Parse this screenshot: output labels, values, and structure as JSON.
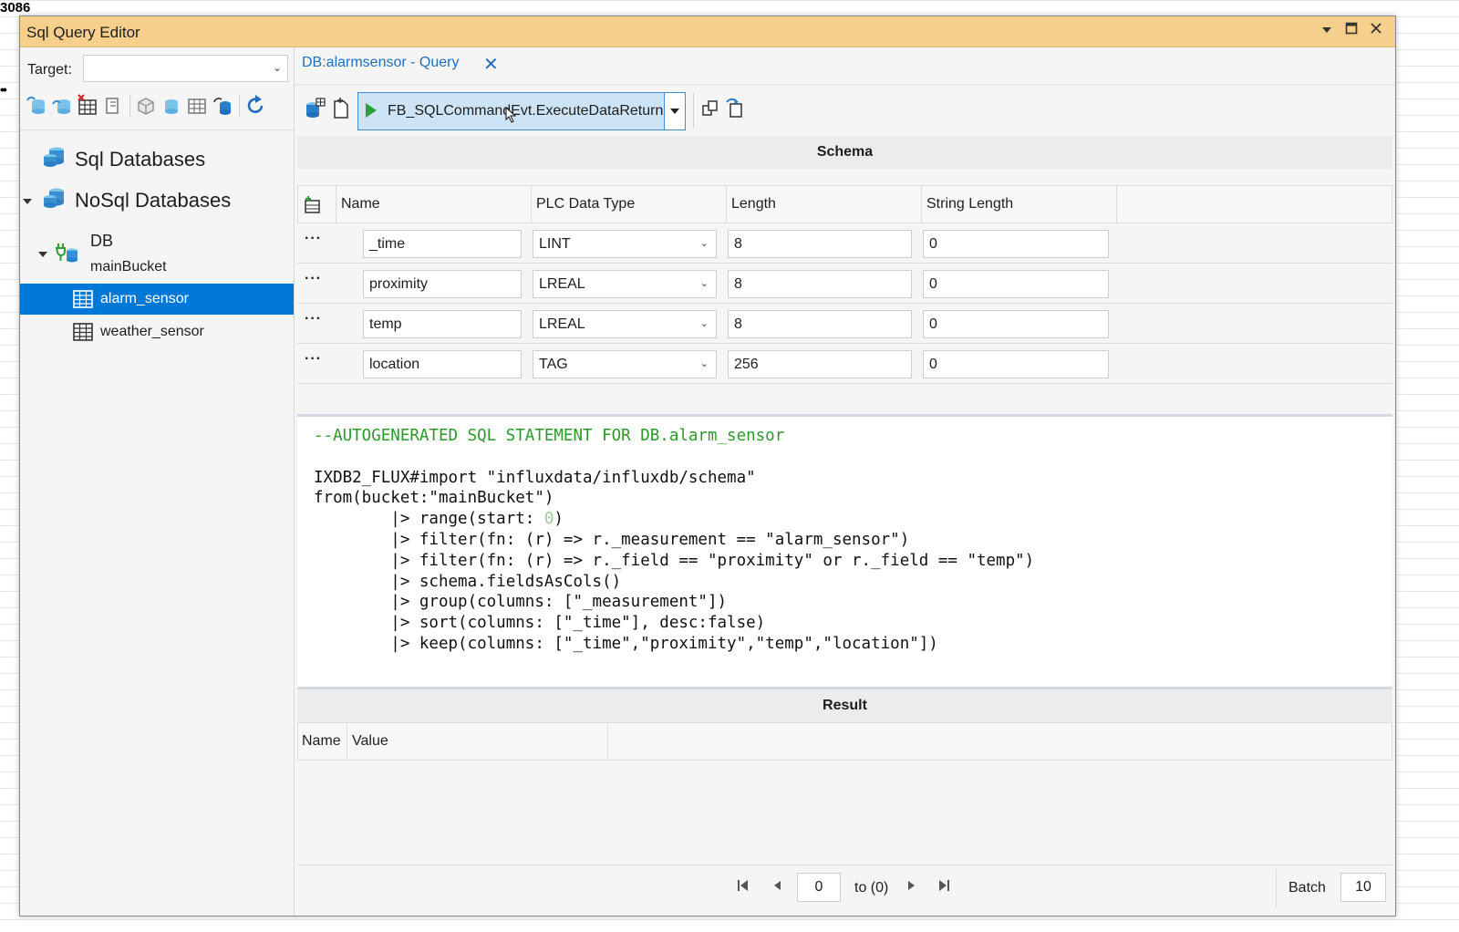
{
  "background": {
    "corner_number": "3086",
    "dots": "••"
  },
  "window": {
    "title": "Sql Query Editor"
  },
  "left_panel": {
    "target_label": "Target:",
    "target_value": "",
    "tree": [
      {
        "label": "Sql Databases",
        "icon": "database-icon"
      },
      {
        "label": "NoSql Databases",
        "icon": "database-icon"
      },
      {
        "label": "DB",
        "sublabel": "mainBucket",
        "icon": "database-connected-icon"
      },
      {
        "label": "alarm_sensor",
        "icon": "table-icon",
        "selected": true
      },
      {
        "label": "weather_sensor",
        "icon": "table-icon"
      }
    ]
  },
  "tab": {
    "label": "DB:alarmsensor - Query",
    "close": "✕"
  },
  "query_toolbar": {
    "run_label": "FB_SQLCommandEvt.ExecuteDataReturn"
  },
  "schema": {
    "title": "Schema",
    "columns": [
      "Name",
      "PLC Data Type",
      "Length",
      "String Length"
    ],
    "rows": [
      {
        "name": "_time",
        "type": "LINT",
        "length": "8",
        "string_length": "0"
      },
      {
        "name": "proximity",
        "type": "LREAL",
        "length": "8",
        "string_length": "0"
      },
      {
        "name": "temp",
        "type": "LREAL",
        "length": "8",
        "string_length": "0"
      },
      {
        "name": "location",
        "type": "TAG",
        "length": "256",
        "string_length": "0"
      }
    ]
  },
  "sql": {
    "comment": "--AUTOGENERATED SQL STATEMENT FOR DB.alarm_sensor",
    "lines": [
      "IXDB2_FLUX#import \"influxdata/influxdb/schema\"",
      "from(bucket:\"mainBucket\")",
      "        |> range(start: ",
      "        |> filter(fn: (r) => r._measurement == \"alarm_sensor\")",
      "        |> filter(fn: (r) => r._field == \"proximity\" or r._field == \"temp\")",
      "        |> schema.fieldsAsCols()",
      "        |> group(columns: [\"_measurement\"])",
      "        |> sort(columns: [\"_time\"], desc:false)",
      "        |> keep(columns: [\"_time\",\"proximity\",\"temp\",\"location\"])"
    ],
    "range_start_value": "0",
    "range_close": ")"
  },
  "result": {
    "title": "Result",
    "columns": [
      "Name",
      "Value"
    ]
  },
  "pager": {
    "page_value": "0",
    "to_label": "to (0)",
    "batch_label": "Batch",
    "batch_value": "10"
  },
  "colors": {
    "title_bar": "#f5cf8b",
    "selection": "#0078d7",
    "tab_text": "#1f6fbd",
    "comment": "#2a9a2a",
    "run_button_bg": "#cde4f7"
  }
}
